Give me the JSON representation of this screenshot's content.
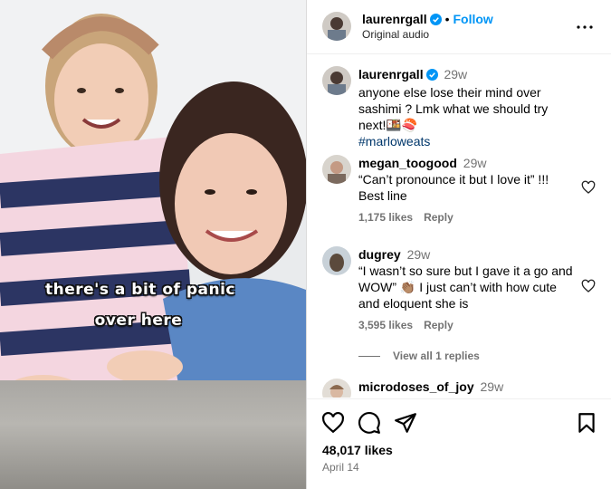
{
  "post": {
    "author": "laurenrgall",
    "follow_label": "Follow",
    "audio": "Original audio",
    "overlay_line1": "there's a bit of panic",
    "overlay_line2": "over here"
  },
  "caption": {
    "user": "laurenrgall",
    "time": "29w",
    "text": "anyone else lose their mind over sashimi ? Lmk what we should try next!🍱🍣",
    "hashtag": "#marloweats"
  },
  "comments": [
    {
      "user": "megan_toogood",
      "time": "29w",
      "text": "“Can’t pronounce it but I love it” !!! Best line",
      "likes": "1,175 likes",
      "reply_label": "Reply"
    },
    {
      "user": "dugrey",
      "time": "29w",
      "text": "“I wasn’t so sure but I gave it a go and WOW” 👏🏽 I just can’t with how cute and eloquent she is",
      "likes": "3,595 likes",
      "reply_label": "Reply",
      "view_replies": "View all 1 replies"
    },
    {
      "user": "microdoses_of_joy",
      "time": "29w"
    }
  ],
  "footer": {
    "likes": "48,017 likes",
    "date": "April 14"
  },
  "icons": [
    "verified-icon",
    "more-options-icon",
    "heart-icon",
    "comment-icon",
    "share-icon",
    "bookmark-icon"
  ],
  "colors": {
    "accent": "#0095f6",
    "hashtag": "#00376b",
    "muted": "#737373"
  }
}
